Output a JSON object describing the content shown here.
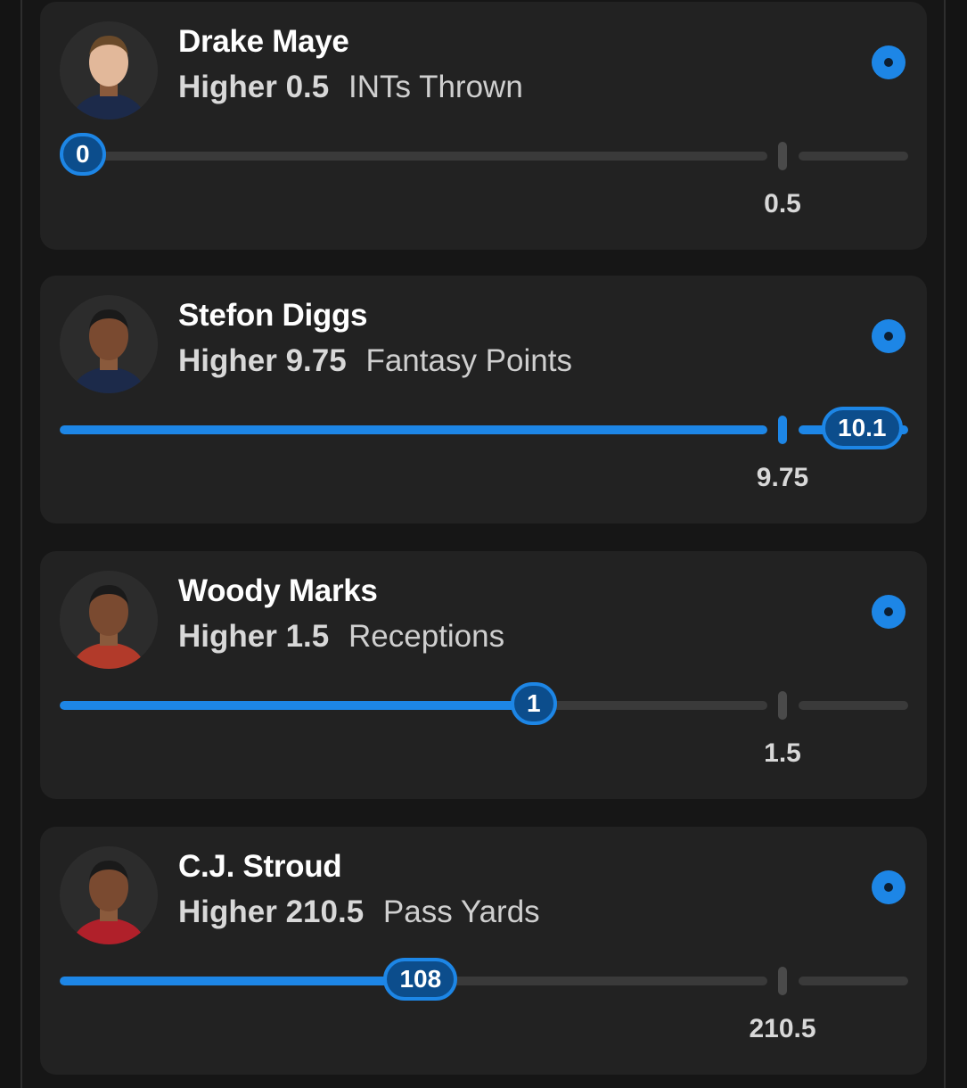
{
  "props": [
    {
      "player": "Drake Maye",
      "direction": "Higher",
      "line": "0.5",
      "stat": "INTs Thrown",
      "current": "0",
      "progress_to_line": 0,
      "avatar_icon": "player-headshot",
      "jersey_color": "#1c2a4a"
    },
    {
      "player": "Stefon Diggs",
      "direction": "Higher",
      "line": "9.75",
      "stat": "Fantasy Points",
      "current": "10.1",
      "progress_to_line": 1,
      "avatar_icon": "player-headshot",
      "jersey_color": "#1c2a4a"
    },
    {
      "player": "Woody Marks",
      "direction": "Higher",
      "line": "1.5",
      "stat": "Receptions",
      "current": "1",
      "progress_to_line": 0.67,
      "avatar_icon": "player-headshot",
      "jersey_color": "#b23a2a"
    },
    {
      "player": "C.J. Stroud",
      "direction": "Higher",
      "line": "210.5",
      "stat": "Pass Yards",
      "current": "108",
      "progress_to_line": 0.51,
      "avatar_icon": "player-headshot",
      "jersey_color": "#b0202a"
    }
  ],
  "colors": {
    "accent": "#1d86e6",
    "card": "#222222",
    "background": "#141414"
  }
}
